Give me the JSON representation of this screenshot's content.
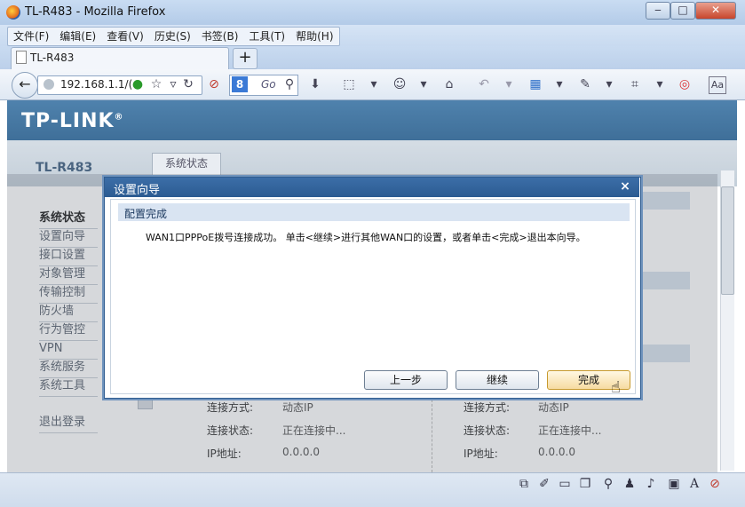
{
  "window": {
    "title": "TL-R483 - Mozilla Firefox"
  },
  "menu": [
    "文件(F)",
    "编辑(E)",
    "查看(V)",
    "历史(S)",
    "书签(B)",
    "工具(T)",
    "帮助(H)"
  ],
  "tab": {
    "label": "TL-R483",
    "new_tab": "+"
  },
  "nav": {
    "url": "192.168.1.1/(",
    "search_engine": "8",
    "search_go": "Go"
  },
  "page": {
    "logo": "TP-LINK",
    "logo_mark": "®",
    "model": "TL-R483",
    "status_tab": "系统状态",
    "sidebar": [
      "系统状态",
      "设置向导",
      "接口设置",
      "对象管理",
      "传输控制",
      "防火墙",
      "行为管控",
      "VPN",
      "系统服务",
      "系统工具",
      "退出登录"
    ],
    "rows": {
      "conn_mode_label": "连接方式:",
      "conn_mode_value": "动态IP",
      "conn_state_label": "连接状态:",
      "conn_state_value": "正在连接中...",
      "ip_label": "IP地址:",
      "ip_value": "0.0.0.0"
    }
  },
  "dialog": {
    "title": "设置向导",
    "close": "×",
    "heading": "配置完成",
    "message": "WAN1口PPPoE拨号连接成功。 单击<继续>进行其他WAN口的设置，或者单击<完成>退出本向导。",
    "buttons": {
      "prev": "上一步",
      "continue": "继续",
      "finish": "完成"
    }
  },
  "colors": {
    "banner": "#4a7aa6",
    "dialog_title": "#2f6099",
    "accent_finish": "#f6dba1"
  }
}
